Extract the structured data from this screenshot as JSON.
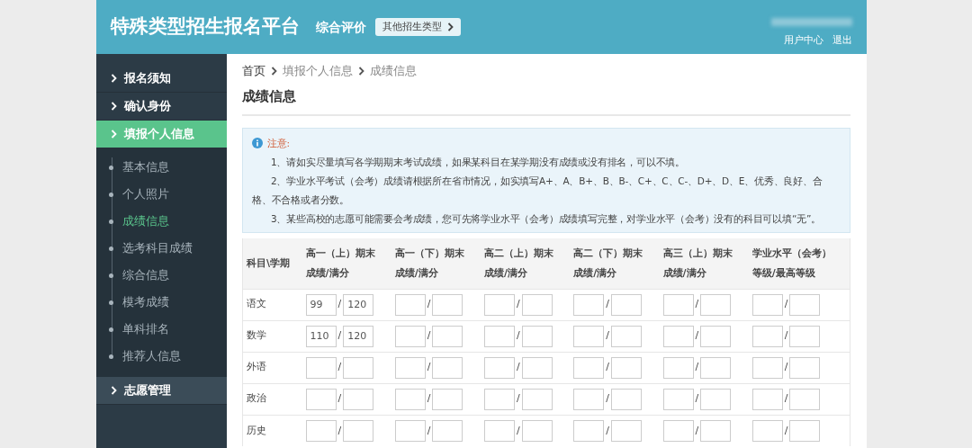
{
  "header": {
    "title": "特殊类型招生报名平台",
    "section": "综合评价",
    "switch_button": "其他招生类型",
    "user_links": [
      "用户中心",
      "退出"
    ]
  },
  "sidebar": {
    "items": [
      {
        "label": "报名须知",
        "selected": false
      },
      {
        "label": "确认身份",
        "selected": false
      },
      {
        "label": "填报个人信息",
        "selected": true,
        "children": [
          {
            "label": "基本信息",
            "selected": false
          },
          {
            "label": "个人照片",
            "selected": false
          },
          {
            "label": "成绩信息",
            "selected": true
          },
          {
            "label": "选考科目成绩",
            "selected": false
          },
          {
            "label": "综合信息",
            "selected": false
          },
          {
            "label": "模考成绩",
            "selected": false
          },
          {
            "label": "单科排名",
            "selected": false
          },
          {
            "label": "推荐人信息",
            "selected": false
          }
        ]
      },
      {
        "label": "志愿管理",
        "selected": false
      }
    ]
  },
  "breadcrumb": [
    "首页",
    "填报个人信息",
    "成绩信息"
  ],
  "page_title": "成绩信息",
  "notice": {
    "heading": "注意:",
    "lines": [
      "1、请如实尽量填写各学期期末考试成绩，如果某科目在某学期没有成绩或没有排名，可以不填。",
      "2、学业水平考试（会考）成绩请根据所在省市情况，如实填写A+、A、B+、B、B-、C+、C、C-、D+、D、E、优秀、良好、合格、不合格或者分数。",
      "3、某些高校的志愿可能需要会考成绩，您可先将学业水平（会考）成绩填写完整，对学业水平（会考）没有的科目可以填“无”。"
    ]
  },
  "table": {
    "columns": [
      {
        "line1": "科目\\学期"
      },
      {
        "line1": "高一（上）期末",
        "line2": "成绩/满分"
      },
      {
        "line1": "高一（下）期末",
        "line2": "成绩/满分"
      },
      {
        "line1": "高二（上）期末",
        "line2": "成绩/满分"
      },
      {
        "line1": "高二（下）期末",
        "line2": "成绩/满分"
      },
      {
        "line1": "高三（上）期末",
        "line2": "成绩/满分"
      },
      {
        "line1": "学业水平（会考）",
        "line2": "等级/最高等级"
      }
    ],
    "separator": "/",
    "rows": [
      {
        "subject": "语文",
        "cells": [
          {
            "score": "99",
            "max": "120"
          },
          {},
          {},
          {},
          {},
          {}
        ]
      },
      {
        "subject": "数学",
        "cells": [
          {
            "score": "110",
            "max": "120"
          },
          {},
          {},
          {},
          {},
          {}
        ]
      },
      {
        "subject": "外语",
        "cells": [
          {},
          {},
          {},
          {},
          {},
          {}
        ]
      },
      {
        "subject": "政治",
        "cells": [
          {},
          {},
          {},
          {},
          {},
          {}
        ]
      },
      {
        "subject": "历史",
        "cells": [
          {},
          {},
          {},
          {},
          {},
          {}
        ]
      }
    ]
  }
}
